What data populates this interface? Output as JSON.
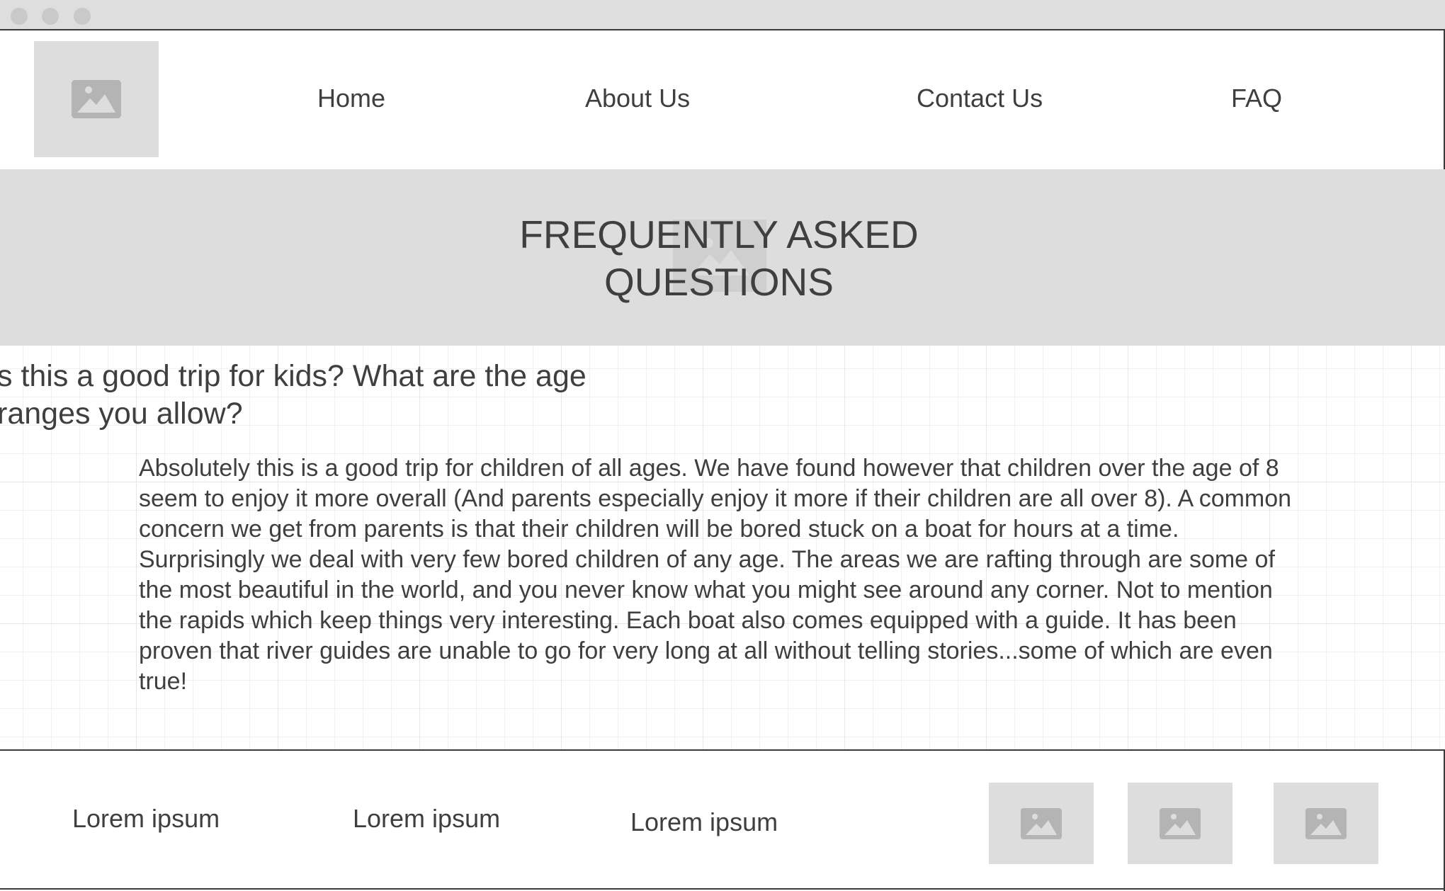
{
  "nav": {
    "items": [
      "Home",
      "About Us",
      "Contact Us",
      "FAQ"
    ]
  },
  "hero": {
    "title_line1": "FREQUENTLY ASKED",
    "title_line2": "QUESTIONS"
  },
  "faq": {
    "question": "s this a good trip for kids? What are the age ranges you allow?",
    "answer": "Absolutely this is a good trip for children of all ages. We have found however that children over the age of 8 seem to enjoy it more overall (And parents especially enjoy it more if their children are all over 8). A common concern we get from parents is that their children will be bored stuck on a boat for hours at a time. Surprisingly we deal with very few bored children of any age. The areas we are rafting through are some of the most beautiful in the world, and you never know what you might see around any corner. Not to mention the rapids which keep things very interesting. Each boat also comes equipped with a guide. It has been proven that river guides are unable to go for very long at all without telling stories...some of which are even true!"
  },
  "footer": {
    "links": [
      "Lorem ipsum",
      "Lorem ipsum",
      "Lorem ipsum"
    ]
  },
  "icons": {
    "placeholder": "image-placeholder-icon"
  },
  "colors": {
    "placeholder_bg": "#dddddd",
    "icon": "#b4b4b4",
    "text": "#3f3f3f",
    "border": "#3a3a3a"
  }
}
